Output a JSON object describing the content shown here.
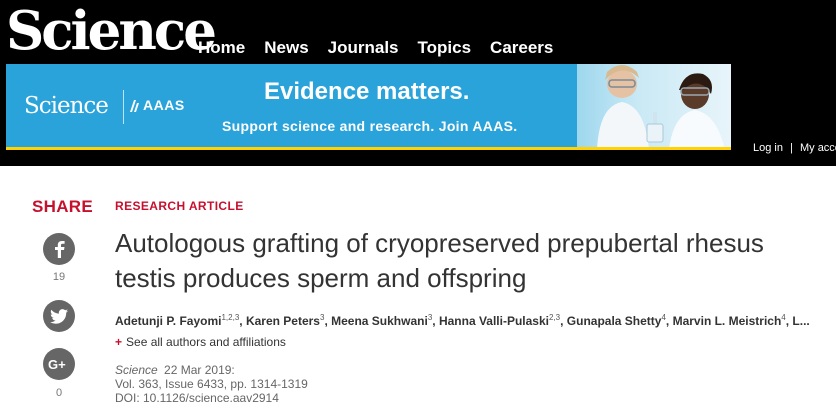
{
  "header": {
    "logo_text": "Science",
    "nav": [
      "Home",
      "News",
      "Journals",
      "Topics",
      "Careers"
    ],
    "bg_color": "#000000"
  },
  "banner": {
    "logo_text": "Science",
    "partner_text": "AAAS",
    "headline": "Evidence matters.",
    "subtext": "Support science and research. Join AAAS.",
    "bg_color": "#2aa3da",
    "accent_color": "#ffd200"
  },
  "account": {
    "login": "Log in",
    "separator": "|",
    "my_account": "My acco"
  },
  "share": {
    "label": "SHARE",
    "buttons": [
      {
        "icon": "facebook-icon",
        "count": "19"
      },
      {
        "icon": "twitter-icon",
        "count": ""
      },
      {
        "icon": "google-plus-icon",
        "count": "0"
      }
    ]
  },
  "article": {
    "section": "RESEARCH ARTICLE",
    "title": "Autologous grafting of cryopreserved prepubertal rhesus testis produces sperm and offspring",
    "authors": [
      {
        "name": "Adetunji P. Fayomi",
        "affil": "1,2,3"
      },
      {
        "name": "Karen Peters",
        "affil": "3"
      },
      {
        "name": "Meena Sukhwani",
        "affil": "3"
      },
      {
        "name": "Hanna Valli-Pulaski",
        "affil": "2,3"
      },
      {
        "name": "Gunapala Shetty",
        "affil": "4"
      },
      {
        "name": "Marvin L. Meistrich",
        "affil": "4"
      }
    ],
    "authors_more": "L...",
    "see_all": "See all authors and affiliations",
    "journal": "Science",
    "date": "22 Mar 2019:",
    "volume_line": "Vol. 363, Issue 6433, pp. 1314-1319",
    "doi_line": "DOI: 10.1126/science.aav2914",
    "accent_color": "#c6102e"
  }
}
